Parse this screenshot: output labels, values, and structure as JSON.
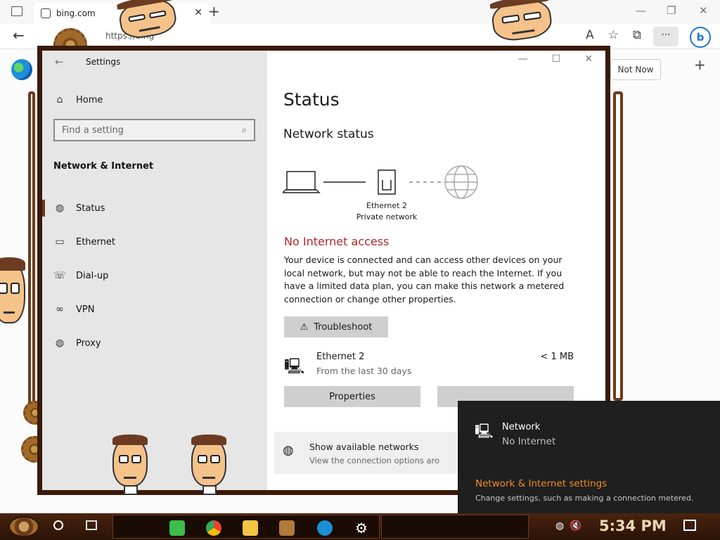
{
  "browser": {
    "tab_title": "bing.com",
    "tab_close": "✕",
    "new_tab": "+",
    "url": "https://bing",
    "not_now": "Not Now",
    "page_plus": "+",
    "more": "···",
    "bing": "b",
    "win_min": "—",
    "win_restore": "❐",
    "win_close": "✕"
  },
  "settings": {
    "window_title": "Settings",
    "home": "Home",
    "search_placeholder": "Find a setting",
    "section": "Network & Internet",
    "nav": [
      {
        "label": "Status",
        "icon": "globe-icon"
      },
      {
        "label": "Ethernet",
        "icon": "ethernet-icon"
      },
      {
        "label": "Dial-up",
        "icon": "dialup-icon"
      },
      {
        "label": "VPN",
        "icon": "vpn-icon"
      },
      {
        "label": "Proxy",
        "icon": "proxy-globe-icon"
      }
    ],
    "page_title": "Status",
    "network_status": "Network status",
    "adapter_name": "Ethernet 2",
    "adapter_type": "Private network",
    "alert": "No Internet access",
    "description": "Your device is connected and can access other devices on your local network, but may not be able to reach the Internet. If you have a limited data plan, you can make this network a metered connection or change other properties.",
    "troubleshoot": "Troubleshoot",
    "connection": {
      "name": "Ethernet 2",
      "sub": "From the last 30 days",
      "usage": "< 1 MB"
    },
    "properties": "Properties",
    "show_networks": "Show available networks",
    "show_networks_sub": "View the connection options aro"
  },
  "flyout": {
    "name": "Network",
    "status": "No Internet",
    "link": "Network & Internet settings",
    "sub": "Change settings, such as making a connection metered."
  },
  "taskbar": {
    "clock": "5:34 PM"
  },
  "colors": {
    "alert_red": "#b4262a",
    "flyout_link": "#f08b28",
    "frame_brown": "#3a1a0a"
  }
}
